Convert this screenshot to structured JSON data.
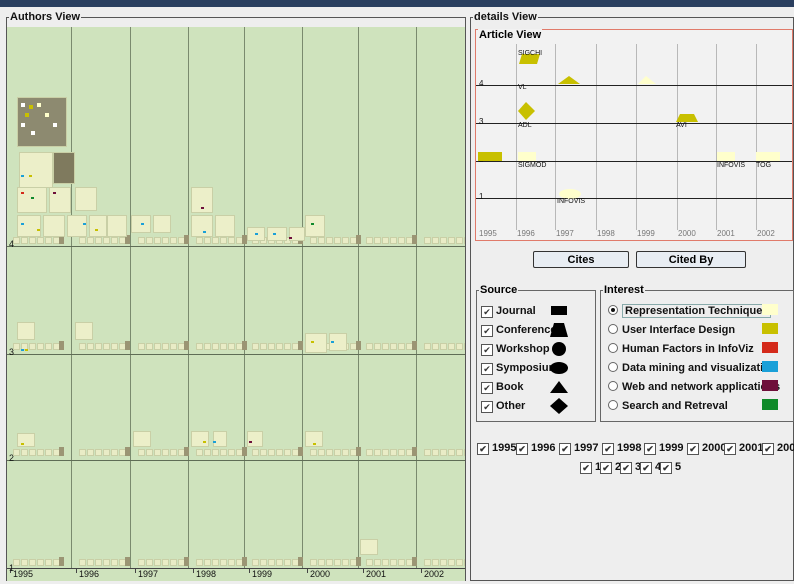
{
  "panels": {
    "authors_title": "Authors View",
    "details_title": "details View",
    "article_title": "Article View"
  },
  "authors_view": {
    "years": [
      "1995",
      "1996",
      "1997",
      "1998",
      "1999",
      "2000",
      "2001",
      "2002"
    ],
    "levels": [
      "4",
      "3",
      "2",
      "1"
    ]
  },
  "article_view": {
    "years": [
      "1995",
      "1996",
      "1997",
      "1998",
      "1999",
      "2000",
      "2001",
      "2002"
    ],
    "levels": [
      "4",
      "3",
      "2",
      "1"
    ],
    "glyph_labels": {
      "sigchi": "SIGCHI",
      "vl": "VL",
      "adl": "ADL",
      "avi": "AVI",
      "sigmod": "SIGMOD",
      "infovis_2001": "INFOVIS",
      "tog": "TOG",
      "infovis_1997": "INFOVIS"
    }
  },
  "buttons": {
    "cites": "Cites",
    "cited_by": "Cited By"
  },
  "source": {
    "title": "Source",
    "items": [
      {
        "label": "Journal",
        "shape": "rectangle"
      },
      {
        "label": "Conference",
        "shape": "trapezoid"
      },
      {
        "label": "Workshop",
        "shape": "circle"
      },
      {
        "label": "Symposium",
        "shape": "ellipse"
      },
      {
        "label": "Book",
        "shape": "triangle"
      },
      {
        "label": "Other",
        "shape": "diamond"
      }
    ]
  },
  "interest": {
    "title": "Interest",
    "selected": "Representation Techniques",
    "items": [
      {
        "label": "Representation Techniques",
        "color": "#ffffcc"
      },
      {
        "label": "User Interface Design",
        "color": "#c8c000"
      },
      {
        "label": "Human Factors in InfoViz",
        "color": "#d42a1a"
      },
      {
        "label": "Data mining and visualization",
        "color": "#1aa0d8"
      },
      {
        "label": "Web and network applications",
        "color": "#6e0f3a"
      },
      {
        "label": "Search and Retreval",
        "color": "#108a2a"
      }
    ]
  },
  "year_filters": [
    "1995",
    "1996",
    "1997",
    "1998",
    "1999",
    "2000",
    "2001",
    "200"
  ],
  "level_filters": [
    "1",
    "2",
    "3",
    "4",
    "5"
  ],
  "check_mark": "✔"
}
